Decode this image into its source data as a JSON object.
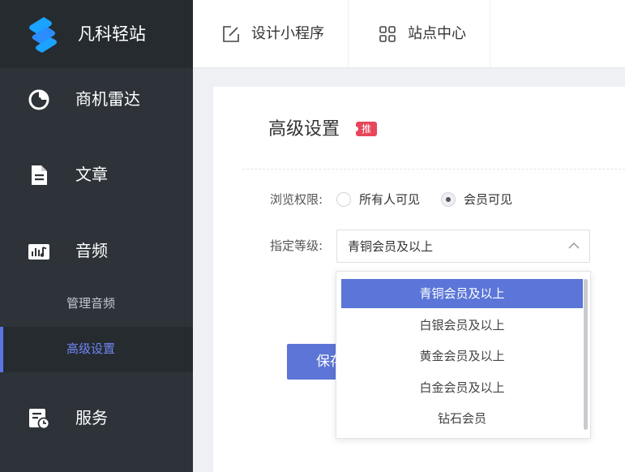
{
  "brand": {
    "name": "凡科轻站"
  },
  "sidebar": {
    "items": [
      {
        "label": "商机雷达",
        "icon": "radar-icon"
      },
      {
        "label": "文章",
        "icon": "document-icon"
      },
      {
        "label": "音频",
        "icon": "audio-icon"
      },
      {
        "label": "服务",
        "icon": "service-icon"
      }
    ],
    "audio_subitems": [
      {
        "label": "管理音频",
        "active": false
      },
      {
        "label": "高级设置",
        "active": true
      }
    ]
  },
  "topbar": {
    "tabs": [
      {
        "label": "设计小程序",
        "icon": "edit-icon"
      },
      {
        "label": "站点中心",
        "icon": "grid-icon"
      }
    ]
  },
  "panel": {
    "title": "高级设置",
    "badge": "推",
    "browse_permission": {
      "label": "浏览权限:",
      "options": [
        {
          "label": "所有人可见",
          "checked": false
        },
        {
          "label": "会员可见",
          "checked": true
        }
      ]
    },
    "level": {
      "label": "指定等级:",
      "selected": "青铜会员及以上",
      "options": [
        "青铜会员及以上",
        "白银会员及以上",
        "黄金会员及以上",
        "白金会员及以上",
        "钻石会员"
      ]
    },
    "save_label": "保存"
  },
  "colors": {
    "sidebar_bg": "#2d3338",
    "accent": "#5c75d6",
    "badge": "#e8465a"
  }
}
